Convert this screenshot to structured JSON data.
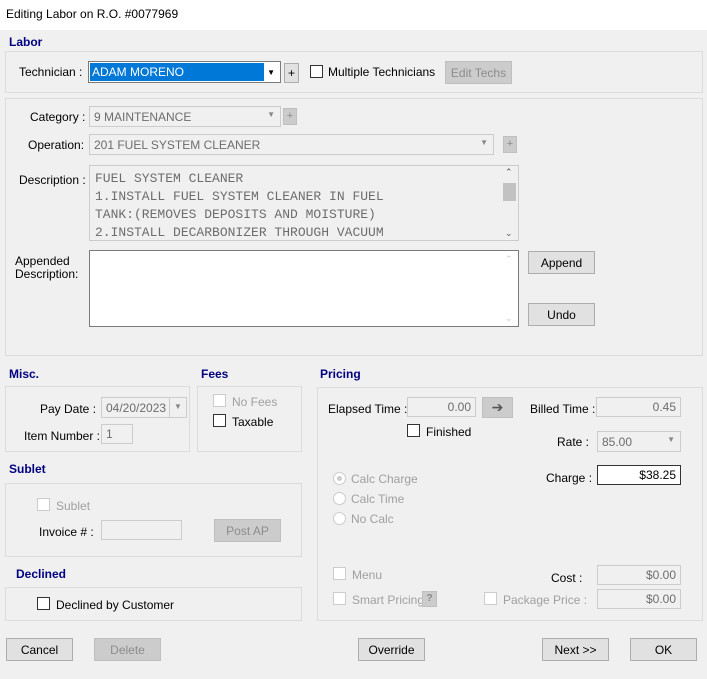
{
  "title": "Editing Labor on R.O. #0077969",
  "labor": {
    "heading": "Labor",
    "technician_label": "Technician :",
    "technician_value": "ADAM MORENO",
    "add": "+",
    "multiple_techs": "Multiple Technicians",
    "edit_techs": "Edit Techs"
  },
  "details": {
    "category_label": "Category :",
    "category_value": "9 MAINTENANCE",
    "operation_label": "Operation:",
    "operation_value": "201 FUEL SYSTEM CLEANER",
    "add": "+",
    "description_label": "Description :",
    "description_lines": [
      "FUEL SYSTEM CLEANER",
      "1.INSTALL FUEL SYSTEM CLEANER IN FUEL",
      "TANK:(REMOVES DEPOSITS AND MOISTURE)",
      "2.INSTALL DECARBONIZER THROUGH VACUUM"
    ],
    "appended_label_1": "Appended",
    "appended_label_2": "Description:",
    "appended_value": "",
    "append": "Append",
    "undo": "Undo"
  },
  "misc": {
    "heading": "Misc.",
    "pay_date_label": "Pay Date :",
    "pay_date": "04/20/2023",
    "item_number_label": "Item Number :",
    "item_number": "1"
  },
  "fees": {
    "heading": "Fees",
    "no_fees": "No Fees",
    "taxable": "Taxable"
  },
  "sublet": {
    "heading": "Sublet",
    "sublet": "Sublet",
    "invoice_label": "Invoice # :",
    "invoice_value": "",
    "post_ap": "Post AP"
  },
  "declined": {
    "heading": "Declined",
    "declined_by_customer": "Declined by Customer"
  },
  "pricing": {
    "heading": "Pricing",
    "elapsed_label": "Elapsed Time :",
    "elapsed": "0.00",
    "finished": "Finished",
    "billed_label": "Billed Time :",
    "billed": "0.45",
    "rate_label": "Rate :",
    "rate": "85.00",
    "charge_label": "Charge :",
    "charge": "$38.25",
    "calc_charge": "Calc Charge",
    "calc_time": "Calc Time",
    "no_calc": "No Calc",
    "menu": "Menu",
    "smart_pricing": "Smart Pricing",
    "help": "?",
    "cost_label": "Cost :",
    "cost": "$0.00",
    "package_price_label": "Package Price :",
    "package_price": "$0.00"
  },
  "footer": {
    "cancel": "Cancel",
    "delete": "Delete",
    "override": "Override",
    "next": "Next >>",
    "ok": "OK"
  }
}
